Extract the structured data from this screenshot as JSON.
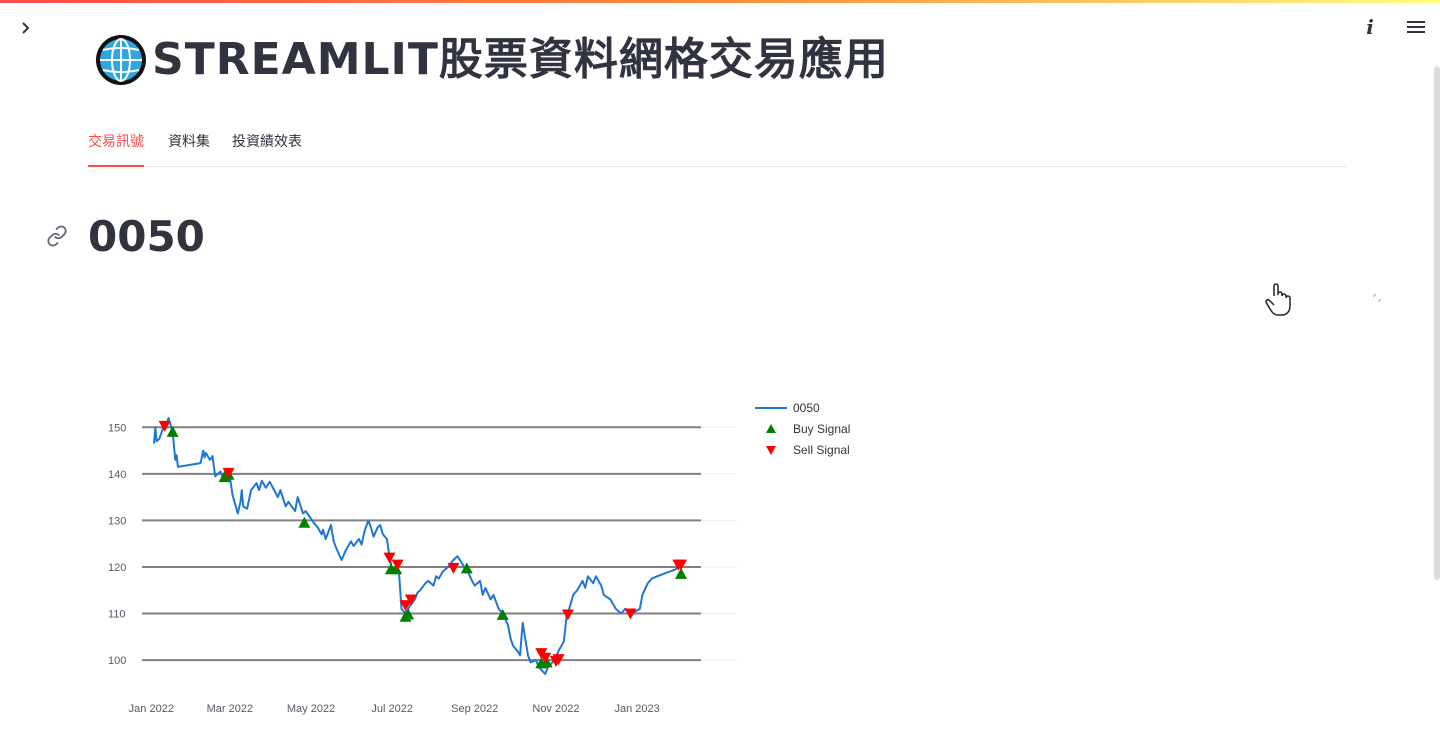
{
  "app": {
    "title": "STREAMLIT股票資料網格交易應用",
    "globe_icon": "globe-icon"
  },
  "tabs": [
    {
      "label": "交易訊號",
      "active": true
    },
    {
      "label": "資料集",
      "active": false
    },
    {
      "label": "投資績效表",
      "active": false
    }
  ],
  "section": {
    "heading": "0050"
  },
  "colors": {
    "accent": "#ff4b4b",
    "line": "#1f77d4",
    "buy": "#008000",
    "sell": "#ff0000",
    "grid": "#808080"
  },
  "chart_data": {
    "type": "line",
    "series": [
      {
        "name": "0050",
        "points": [
          [
            "2022-01-03",
            146.5
          ],
          [
            "2022-01-04",
            150.0
          ],
          [
            "2022-01-05",
            147.0
          ],
          [
            "2022-01-07",
            147.5
          ],
          [
            "2022-01-10",
            150.0
          ],
          [
            "2022-01-12",
            150.5
          ],
          [
            "2022-01-14",
            152.0
          ],
          [
            "2022-01-17",
            149.0
          ],
          [
            "2022-01-19",
            143.0
          ],
          [
            "2022-01-20",
            144.0
          ],
          [
            "2022-01-21",
            141.5
          ],
          [
            "2022-02-07",
            142.3
          ],
          [
            "2022-02-09",
            145.0
          ],
          [
            "2022-02-10",
            143.5
          ],
          [
            "2022-02-11",
            144.5
          ],
          [
            "2022-02-14",
            143.0
          ],
          [
            "2022-02-16",
            143.8
          ],
          [
            "2022-02-18",
            139.5
          ],
          [
            "2022-02-22",
            140.5
          ],
          [
            "2022-02-24",
            139.0
          ],
          [
            "2022-02-25",
            140.3
          ],
          [
            "2022-03-01",
            139.5
          ],
          [
            "2022-03-03",
            135.5
          ],
          [
            "2022-03-07",
            131.5
          ],
          [
            "2022-03-09",
            134.0
          ],
          [
            "2022-03-10",
            136.5
          ],
          [
            "2022-03-11",
            133.0
          ],
          [
            "2022-03-14",
            132.5
          ],
          [
            "2022-03-17",
            136.5
          ],
          [
            "2022-03-21",
            138.0
          ],
          [
            "2022-03-23",
            136.5
          ],
          [
            "2022-03-25",
            138.5
          ],
          [
            "2022-03-28",
            137.0
          ],
          [
            "2022-03-31",
            138.3
          ],
          [
            "2022-04-06",
            135.0
          ],
          [
            "2022-04-08",
            136.5
          ],
          [
            "2022-04-12",
            133.0
          ],
          [
            "2022-04-14",
            134.0
          ],
          [
            "2022-04-19",
            132.0
          ],
          [
            "2022-04-21",
            135.0
          ],
          [
            "2022-04-25",
            131.5
          ],
          [
            "2022-04-27",
            132.0
          ],
          [
            "2022-05-03",
            129.5
          ],
          [
            "2022-05-06",
            128.5
          ],
          [
            "2022-05-09",
            127.0
          ],
          [
            "2022-05-10",
            128.0
          ],
          [
            "2022-05-12",
            126.0
          ],
          [
            "2022-05-16",
            129.0
          ],
          [
            "2022-05-18",
            125.5
          ],
          [
            "2022-05-20",
            124.0
          ],
          [
            "2022-05-24",
            121.5
          ],
          [
            "2022-05-27",
            123.5
          ],
          [
            "2022-05-31",
            125.5
          ],
          [
            "2022-06-02",
            124.5
          ],
          [
            "2022-06-06",
            126.0
          ],
          [
            "2022-06-08",
            124.8
          ],
          [
            "2022-06-10",
            127.5
          ],
          [
            "2022-06-13",
            130.0
          ],
          [
            "2022-06-15",
            128.5
          ],
          [
            "2022-06-17",
            126.5
          ],
          [
            "2022-06-20",
            128.5
          ],
          [
            "2022-06-22",
            129.0
          ],
          [
            "2022-06-24",
            127.0
          ],
          [
            "2022-06-27",
            126.0
          ],
          [
            "2022-06-29",
            122.0
          ],
          [
            "2022-07-01",
            119.5
          ],
          [
            "2022-07-04",
            120.0
          ],
          [
            "2022-07-06",
            119.0
          ],
          [
            "2022-07-08",
            111.0
          ],
          [
            "2022-07-11",
            110.0
          ],
          [
            "2022-07-12",
            110.5
          ],
          [
            "2022-07-14",
            111.5
          ],
          [
            "2022-07-18",
            113.0
          ],
          [
            "2022-07-20",
            114.5
          ],
          [
            "2022-07-22",
            115.0
          ],
          [
            "2022-07-26",
            116.5
          ],
          [
            "2022-07-28",
            117.0
          ],
          [
            "2022-08-01",
            116.0
          ],
          [
            "2022-08-03",
            118.0
          ],
          [
            "2022-08-05",
            117.5
          ],
          [
            "2022-08-08",
            119.0
          ],
          [
            "2022-08-10",
            119.5
          ],
          [
            "2022-08-12",
            120.0
          ],
          [
            "2022-08-16",
            121.5
          ],
          [
            "2022-08-19",
            122.3
          ],
          [
            "2022-08-22",
            121.0
          ],
          [
            "2022-08-24",
            120.0
          ],
          [
            "2022-08-26",
            119.5
          ],
          [
            "2022-08-30",
            117.0
          ],
          [
            "2022-09-01",
            116.0
          ],
          [
            "2022-09-05",
            117.0
          ],
          [
            "2022-09-07",
            114.0
          ],
          [
            "2022-09-09",
            115.5
          ],
          [
            "2022-09-13",
            113.0
          ],
          [
            "2022-09-15",
            114.0
          ],
          [
            "2022-09-19",
            111.0
          ],
          [
            "2022-09-22",
            110.0
          ],
          [
            "2022-09-26",
            107.5
          ],
          [
            "2022-09-28",
            104.5
          ],
          [
            "2022-09-30",
            103.0
          ],
          [
            "2022-10-03",
            102.0
          ],
          [
            "2022-10-05",
            101.0
          ],
          [
            "2022-10-07",
            108.0
          ],
          [
            "2022-10-11",
            101.0
          ],
          [
            "2022-10-13",
            99.5
          ],
          [
            "2022-10-17",
            100.0
          ],
          [
            "2022-10-19",
            98.5
          ],
          [
            "2022-10-24",
            97.0
          ],
          [
            "2022-10-26",
            98.5
          ],
          [
            "2022-10-28",
            99.0
          ],
          [
            "2022-11-01",
            100.5
          ],
          [
            "2022-11-03",
            102.0
          ],
          [
            "2022-11-07",
            104.0
          ],
          [
            "2022-11-09",
            109.5
          ],
          [
            "2022-11-11",
            111.0
          ],
          [
            "2022-11-14",
            114.0
          ],
          [
            "2022-11-17",
            115.0
          ],
          [
            "2022-11-21",
            117.0
          ],
          [
            "2022-11-23",
            115.5
          ],
          [
            "2022-11-25",
            118.0
          ],
          [
            "2022-11-29",
            116.5
          ],
          [
            "2022-12-01",
            118.0
          ],
          [
            "2022-12-05",
            116.0
          ],
          [
            "2022-12-07",
            114.0
          ],
          [
            "2022-12-12",
            113.0
          ],
          [
            "2022-12-14",
            112.0
          ],
          [
            "2022-12-16",
            111.0
          ],
          [
            "2022-12-20",
            110.0
          ],
          [
            "2022-12-23",
            111.0
          ],
          [
            "2022-12-28",
            110.0
          ],
          [
            "2023-01-03",
            111.0
          ],
          [
            "2023-01-05",
            114.0
          ],
          [
            "2023-01-09",
            116.5
          ],
          [
            "2023-01-12",
            117.5
          ],
          [
            "2023-01-16",
            118.0
          ],
          [
            "2023-01-30",
            119.5
          ],
          [
            "2023-02-03",
            120.5
          ]
        ]
      }
    ],
    "buy_signals": [
      [
        "2022-01-17",
        149.0
      ],
      [
        "2022-02-25",
        139.3
      ],
      [
        "2022-02-28",
        139.8
      ],
      [
        "2022-04-26",
        129.5
      ],
      [
        "2022-06-30",
        119.5
      ],
      [
        "2022-07-04",
        119.5
      ],
      [
        "2022-07-11",
        109.3
      ],
      [
        "2022-07-13",
        109.8
      ],
      [
        "2022-08-26",
        119.7
      ],
      [
        "2022-09-22",
        109.7
      ],
      [
        "2022-10-21",
        99.3
      ],
      [
        "2022-10-25",
        99.5
      ],
      [
        "2023-02-03",
        118.5
      ]
    ],
    "sell_signals": [
      [
        "2022-01-11",
        150.3
      ],
      [
        "2022-02-28",
        140.2
      ],
      [
        "2022-06-29",
        122.0
      ],
      [
        "2022-07-05",
        120.5
      ],
      [
        "2022-07-11",
        111.8
      ],
      [
        "2022-07-15",
        113.0
      ],
      [
        "2022-08-16",
        119.8
      ],
      [
        "2022-10-21",
        101.5
      ],
      [
        "2022-10-24",
        100.5
      ],
      [
        "2022-11-01",
        99.8
      ],
      [
        "2022-11-03",
        100.2
      ],
      [
        "2022-11-10",
        109.8
      ],
      [
        "2022-12-27",
        110.0
      ],
      [
        "2023-02-01",
        120.5
      ],
      [
        "2023-02-03",
        120.5
      ]
    ],
    "x_ticks": [
      {
        "date": "2022-01-01",
        "label": "Jan 2022"
      },
      {
        "date": "2022-03-01",
        "label": "Mar 2022"
      },
      {
        "date": "2022-05-01",
        "label": "May 2022"
      },
      {
        "date": "2022-07-01",
        "label": "Jul 2022"
      },
      {
        "date": "2022-09-01",
        "label": "Sep 2022"
      },
      {
        "date": "2022-11-01",
        "label": "Nov 2022"
      },
      {
        "date": "2023-01-01",
        "label": "Jan 2023"
      }
    ],
    "y_ticks": [
      100,
      110,
      120,
      130,
      140,
      150
    ],
    "grid_levels": [
      100,
      110,
      120,
      130,
      140,
      150
    ],
    "xlim": [
      "2021-12-25",
      "2023-02-18"
    ],
    "ylim": [
      94,
      155
    ],
    "legend": {
      "placement": "right",
      "items": [
        {
          "label": "0050",
          "kind": "line"
        },
        {
          "label": "Buy Signal",
          "kind": "triangle-up"
        },
        {
          "label": "Sell Signal",
          "kind": "triangle-down"
        }
      ]
    }
  }
}
